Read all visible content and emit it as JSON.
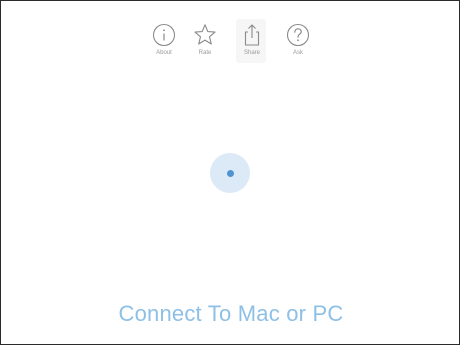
{
  "toolbar": {
    "about_label": "About",
    "rate_label": "Rate",
    "share_label": "Share",
    "ask_label": "Ask",
    "about_icon": "info-icon",
    "rate_icon": "star-icon",
    "share_icon": "share-icon",
    "ask_icon": "question-icon"
  },
  "main": {
    "connect_label": "Connect To Mac or PC"
  },
  "colors": {
    "accent": "#8ec0e6",
    "dot": "#4f94cf",
    "pulse": "#dbeaf6",
    "icon": "#8a8a8a"
  }
}
